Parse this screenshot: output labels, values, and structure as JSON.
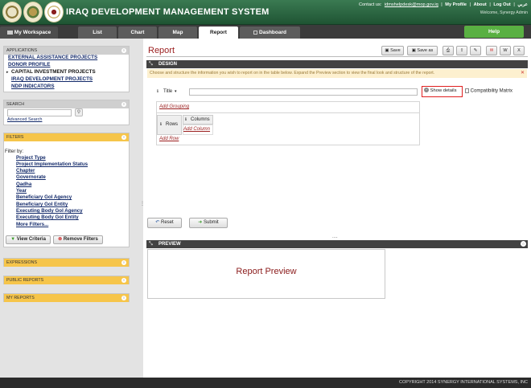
{
  "header": {
    "title": "IRAQ DEVELOPMENT MANAGEMENT SYSTEM",
    "contact_label": "Contact us:",
    "contact_email": "idmshelpdesk@mop.gov.iq",
    "links": [
      "My Profile",
      "About",
      "Log Out",
      "عربي"
    ],
    "welcome": "Welcome, Synergy Admin"
  },
  "tabs": {
    "workspace": "My Workspace",
    "items": [
      "List",
      "Chart",
      "Map",
      "Report",
      "Dashboard"
    ],
    "active": "Report",
    "help": "Help"
  },
  "sidebar": {
    "applications": {
      "heading": "APPLICATIONS",
      "items": [
        "EXTERNAL ASSISTANCE PROJECTS",
        "DONOR PROFILE",
        "CAPITAL INVESTMENT PROJECTS",
        "IRAQ DEVELOPMENT PROJECTS",
        "NDP INDICATORS"
      ],
      "active_index": 2
    },
    "search": {
      "heading": "SEARCH",
      "placeholder": "",
      "advanced": "Advanced Search"
    },
    "filters": {
      "heading": "FILTERS",
      "filter_by": "Filter by:",
      "items": [
        "Project Type",
        "Project Implementation Status",
        "Chapter",
        "Governorate",
        "Qadha",
        "Year",
        "Beneficiary GoI Agency",
        "Beneficiary GoI Entity",
        "Executing Body GoI Agency",
        "Executing Body GoI Entity",
        "More Filters..."
      ],
      "view_criteria": "View Criteria",
      "remove_filters": "Remove Filters"
    },
    "expressions": "EXPRESSIONS",
    "public_reports": "PUBLIC REPORTS",
    "my_reports": "MY REPORTS"
  },
  "main": {
    "title": "Report",
    "toolbar": {
      "save": "Save",
      "save_as": "Save as"
    },
    "design": {
      "heading": "DESIGN",
      "info": "Choose and structure the information you wish to report on in the table below. Expand the Preview section to view the final look and structure of the report.",
      "title_label": "Title",
      "title_value": "",
      "show_details": "Show details",
      "compatibility": "Compatibility Matrix",
      "add_grouping": "Add Grouping",
      "rows_label": "Rows",
      "columns_label": "Columns",
      "add_column": "Add Column",
      "add_row": "Add Row"
    },
    "reset": "Reset",
    "submit": "Submit",
    "preview": {
      "heading": "PREVIEW",
      "text": "Report Preview"
    },
    "ellipsis": "...."
  },
  "footer": "COPYRIGHT 2014 SYNERGY INTERNATIONAL SYSTEMS, INC",
  "colors": {
    "header_green": "#2a6a43",
    "help_green": "#59b042",
    "title_red": "#9a1d1d",
    "filter_orange": "#f6c54a",
    "link_blue": "#132a6a"
  }
}
